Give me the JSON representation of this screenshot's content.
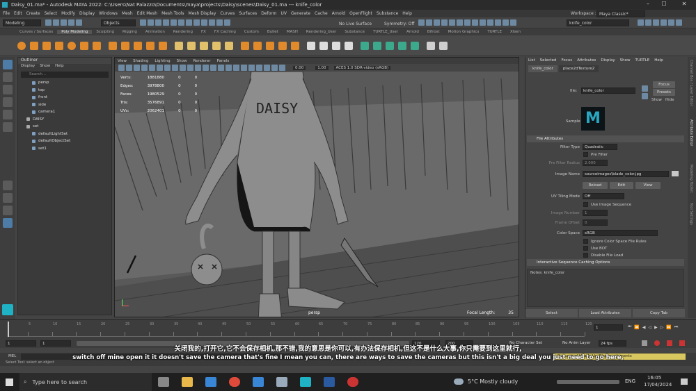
{
  "window": {
    "title": "Daisy_01.ma* - Autodesk MAYA 2022: C:\\Users\\Nat Palazzo\\Documents\\maya\\projects\\Daisy\\scenes\\Daisy_01.ma  ---  knife_color"
  },
  "menu": [
    "File",
    "Edit",
    "Create",
    "Select",
    "Modify",
    "Display",
    "Windows",
    "Mesh",
    "Edit Mesh",
    "Mesh Tools",
    "Mesh Display",
    "Curves",
    "Surfaces",
    "Deform",
    "UV",
    "Generate",
    "Cache",
    "Arnold",
    "OpenFlight",
    "Substance",
    "Help"
  ],
  "workspace": {
    "label": "Workspace :",
    "value": "Maya Classic*"
  },
  "status": {
    "mode": "Modeling",
    "objects": "Objects",
    "live": "No Live Surface",
    "symmetry": "Symmetry: Off",
    "search": "knife_color"
  },
  "shelf_tabs": [
    "Curves / Surfaces",
    "Poly Modeling",
    "Sculpting",
    "Rigging",
    "Animation",
    "Rendering",
    "FX",
    "FX Caching",
    "Custom",
    "Bullet",
    "MASH",
    "Rendering_User",
    "Substance",
    "TURTLE_User",
    "Arnold",
    "Bifrost",
    "Motion Graphics",
    "TURTLE",
    "XGen"
  ],
  "outliner": {
    "title": "Outliner",
    "menu": [
      "Display",
      "Show",
      "Help"
    ],
    "search": "Search...",
    "items": [
      "persp",
      "top",
      "front",
      "side",
      "camera1",
      "DAISY",
      "set",
      "defaultLightSet",
      "defaultObjectSet",
      "set1"
    ]
  },
  "viewport": {
    "menu": [
      "View",
      "Shading",
      "Lighting",
      "Show",
      "Renderer",
      "Panels"
    ],
    "exposure": "0.00",
    "gamma": "1.00",
    "colorspace": "ACES 1.0 SDR-video (sRGB)",
    "hud": [
      [
        "Verts:",
        "1881880",
        "0",
        "0"
      ],
      [
        "Edges:",
        "3978800",
        "0",
        "0"
      ],
      [
        "Faces:",
        "1980529",
        "0",
        "0"
      ],
      [
        "Tris:",
        "3576891",
        "0",
        "0"
      ],
      [
        "UVs:",
        "2062401",
        "0",
        "0"
      ]
    ],
    "camera": "persp",
    "focal_label": "Focal Length:",
    "focal_value": "35",
    "shirt_text": "DAISY"
  },
  "attr": {
    "menu": [
      "List",
      "Selected",
      "Focus",
      "Attributes",
      "Display",
      "Show",
      "TURTLE",
      "Help"
    ],
    "tabs": [
      "knife_color",
      "place2dTexture2"
    ],
    "file_label": "file:",
    "file_value": "knife_color",
    "focus": "Focus",
    "presets": "Presets",
    "show": "Show",
    "hide": "Hide",
    "sample": "Sample",
    "section_file": "File Attributes",
    "filter_type_label": "Filter Type",
    "filter_type": "Quadratic",
    "pre_filter": "Pre Filter",
    "pre_filter_radius_label": "Pre Filter Radius",
    "pre_filter_radius": "2.000",
    "image_name_label": "Image Name",
    "image_name": "sourceimages\\blade_color.jpg",
    "reload": "Reload",
    "edit": "Edit",
    "view": "View",
    "uv_tiling_label": "UV Tiling Mode",
    "uv_tiling": "Off",
    "use_image_seq": "Use Image Sequence",
    "image_number_label": "Image Number",
    "image_number": "1",
    "frame_offset_label": "Frame Offset",
    "frame_offset": "0",
    "color_space_label": "Color Space",
    "color_space": "sRGB",
    "ignore_cs": "Ignore Color Space File Rules",
    "use_bot": "Use BOT",
    "disable_file_load": "Disable File Load",
    "section_caching": "Interactive Sequence Caching Options",
    "notes": "Notes:  knife_color",
    "select": "Select",
    "load": "Load Attributes",
    "copy": "Copy Tab"
  },
  "channelbox": [
    "Channel Box / Layer Editor",
    "Attribute Editor",
    "Modeling Toolkit",
    "Tool Settings"
  ],
  "timeline": {
    "ticks": [
      "5",
      "10",
      "15",
      "20",
      "25",
      "30",
      "35",
      "40",
      "45",
      "50",
      "55",
      "60",
      "65",
      "70",
      "75",
      "80",
      "85",
      "90",
      "95",
      "100",
      "105",
      "110",
      "115",
      "120"
    ],
    "current": "1",
    "start": "1",
    "start2": "1",
    "end1": "120",
    "end2": "120",
    "end3": "200",
    "character": "No Character Set",
    "anim_layer": "No Anim Layer",
    "fps": "24 fps"
  },
  "mel": {
    "label": "MEL",
    "help": "Select Tool: select an object",
    "warning": "Requested Heads Up Display elements"
  },
  "subtitles": {
    "cn": "关闭我的,打开它,它不会保存相机,那不错,我的意思是你可以,有办法保存相机,但这不是什么大事,你只需要到这里就行,",
    "en": "switch off mine open it it doesn't save the camera that's fine I mean you can, there are ways to save the cameras but this isn't a big deal you just need to go here,"
  },
  "taskbar": {
    "search": "Type here to search",
    "weather": "5°C  Mostly cloudy",
    "lang": "ENG",
    "time": "16:05",
    "date": "17/04/2024"
  }
}
